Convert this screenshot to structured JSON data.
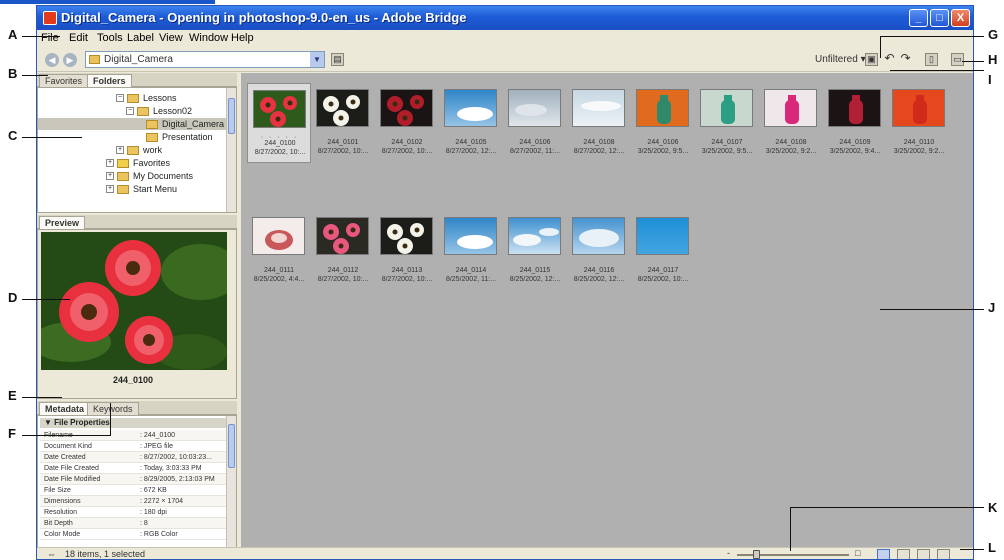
{
  "window": {
    "title": "Digital_Camera - Opening in photoshop-9.0-en_us - Adobe Bridge",
    "buttons": {
      "minimize": "_",
      "maximize": "□",
      "close": "X"
    }
  },
  "menu": [
    "File",
    "Edit",
    "Tools",
    "Label",
    "View",
    "Window",
    "Help"
  ],
  "toolbar": {
    "back_icon": "back-arrow-icon",
    "forward_icon": "forward-arrow-icon",
    "path_value": "Digital_Camera",
    "filter_label": "Unfiltered ▾"
  },
  "left_tabs": {
    "favorites": "Favorites",
    "folders": "Folders"
  },
  "folder_tree": [
    {
      "label": "Lessons",
      "expander": "−"
    },
    {
      "label": "Lesson02",
      "expander": "−"
    },
    {
      "label": "Digital_Camera",
      "expander": "",
      "selected": true
    },
    {
      "label": "Presentation",
      "expander": ""
    },
    {
      "label": "work",
      "expander": "+"
    },
    {
      "label": "Favorites",
      "expander": "+"
    },
    {
      "label": "My Documents",
      "expander": "+"
    },
    {
      "label": "Start Menu",
      "expander": "+"
    }
  ],
  "preview": {
    "tab": "Preview",
    "caption": "244_0100"
  },
  "metadata": {
    "tabs": {
      "metadata": "Metadata",
      "keywords": "Keywords"
    },
    "section": "▼ File Properties",
    "rows": [
      {
        "key": "Filename",
        "value": ": 244_0100"
      },
      {
        "key": "Document Kind",
        "value": ": JPEG file"
      },
      {
        "key": "Date Created",
        "value": ": 8/27/2002, 10:03:23..."
      },
      {
        "key": "Date File Created",
        "value": ": Today, 3:03:33 PM"
      },
      {
        "key": "Date File Modified",
        "value": ": 8/29/2005, 2:13:03 PM"
      },
      {
        "key": "File Size",
        "value": ": 672 KB"
      },
      {
        "key": "Dimensions",
        "value": ": 2272 × 1704"
      },
      {
        "key": "Resolution",
        "value": ": 180 dpi"
      },
      {
        "key": "Bit Depth",
        "value": ": 8"
      },
      {
        "key": "Color Mode",
        "value": ": RGB Color"
      }
    ]
  },
  "thumbnails": [
    {
      "name": "244_0100",
      "date": "8/27/2002, 10:...",
      "selected": true,
      "rating_dots": "· · · · ·",
      "image": "red-flowers"
    },
    {
      "name": "244_0101",
      "date": "8/27/2002, 10:...",
      "image": "white-flowers-dark"
    },
    {
      "name": "244_0102",
      "date": "8/27/2002, 10:...",
      "image": "red-flowers-dark"
    },
    {
      "name": "244_0105",
      "date": "8/27/2002, 12:...",
      "image": "blue-sky-cloud"
    },
    {
      "name": "244_0106",
      "date": "8/27/2002, 11:...",
      "image": "grey-clouds"
    },
    {
      "name": "244_0108",
      "date": "8/27/2002, 12:...",
      "image": "pale-sky"
    },
    {
      "name": "244_0106",
      "date": "3/25/2002, 9:5...",
      "image": "orange-vase"
    },
    {
      "name": "244_0107",
      "date": "3/25/2002, 9:5...",
      "image": "green-vase"
    },
    {
      "name": "244_0108",
      "date": "3/25/2002, 9:2...",
      "image": "pink-vases"
    },
    {
      "name": "244_0109",
      "date": "3/25/2002, 9:4...",
      "image": "dark-vase"
    },
    {
      "name": "244_0110",
      "date": "3/25/2002, 9:2...",
      "image": "red-vase"
    },
    {
      "name": "244_0111",
      "date": "8/25/2002, 4:4...",
      "image": "shell-pink"
    },
    {
      "name": "244_0112",
      "date": "8/27/2002, 10:...",
      "image": "pink-flowers"
    },
    {
      "name": "244_0113",
      "date": "8/27/2002, 10:...",
      "image": "white-flowers-dark"
    },
    {
      "name": "244_0114",
      "date": "8/25/2002, 11:...",
      "image": "blue-sky-cloud"
    },
    {
      "name": "244_0115",
      "date": "8/25/2002, 12:...",
      "image": "sky-clouds"
    },
    {
      "name": "244_0116",
      "date": "8/25/2002, 12:...",
      "image": "sky-clouds-2"
    },
    {
      "name": "244_0117",
      "date": "8/25/2002, 10:...",
      "image": "clear-blue"
    }
  ],
  "status": {
    "text": "18 items, 1 selected"
  },
  "colors": {
    "titlebar": "#1d5bd6",
    "content_bg": "#b0b0b0",
    "chrome": "#ece9d8"
  },
  "callouts": [
    "A",
    "B",
    "C",
    "D",
    "E",
    "F",
    "G",
    "H",
    "I",
    "J",
    "K",
    "L"
  ]
}
